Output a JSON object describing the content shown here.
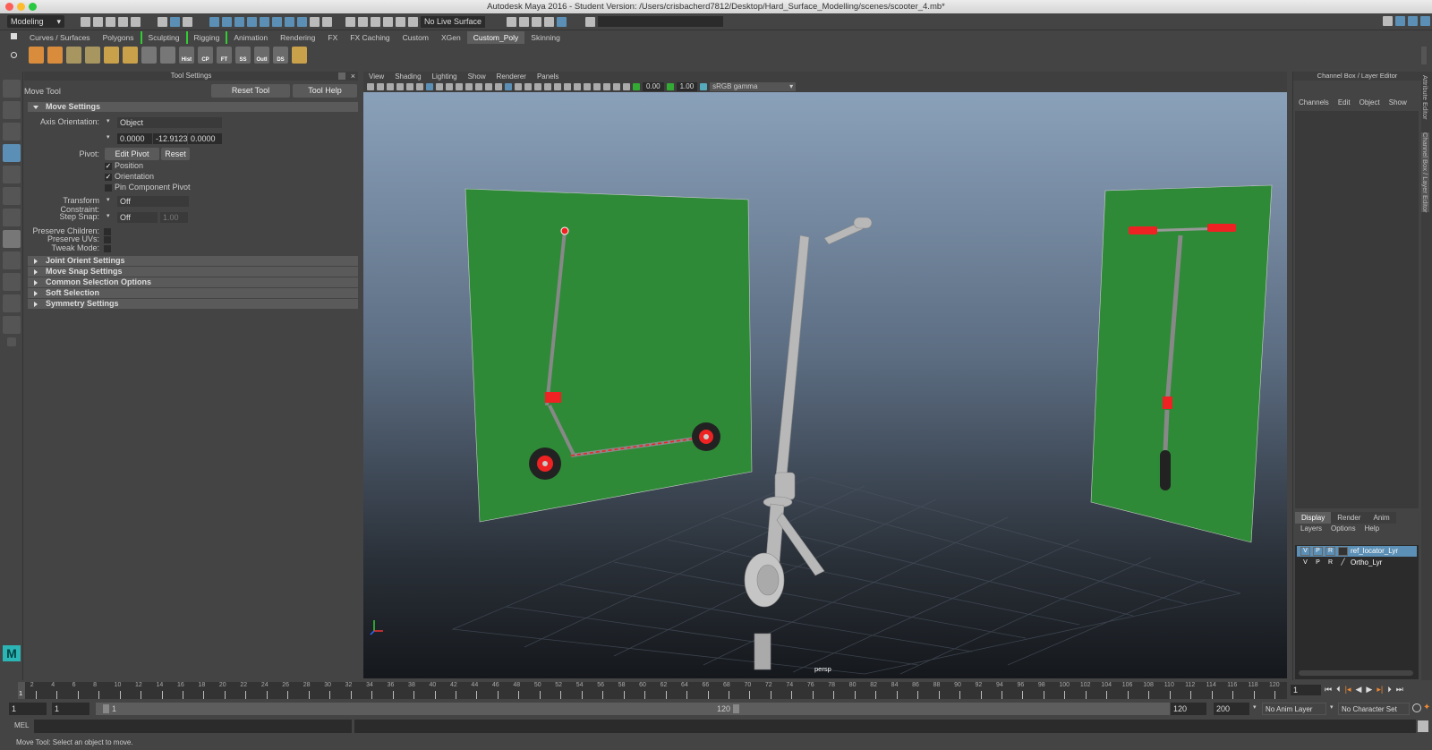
{
  "window": {
    "title": "Autodesk Maya 2016 - Student Version: /Users/crisbacherd7812/Desktop/Hard_Surface_Modelling/scenes/scooter_4.mb*"
  },
  "statusline": {
    "menuset": "Modeling",
    "live_surface": "No Live Surface"
  },
  "shelf": {
    "tabs": [
      "Curves / Surfaces",
      "Polygons",
      "Sculpting",
      "Rigging",
      "Animation",
      "Rendering",
      "FX",
      "FX Caching",
      "Custom",
      "XGen",
      "Custom_Poly",
      "Skinning"
    ],
    "active_tab": "Custom_Poly",
    "buttons": [
      "",
      "",
      "",
      "",
      "",
      "",
      "",
      "Hist",
      "CP",
      "FT",
      "SS",
      "Outl",
      "DS",
      ""
    ]
  },
  "tool_settings": {
    "header": "Tool Settings",
    "tool_name": "Move Tool",
    "reset_tool": "Reset Tool",
    "tool_help": "Tool Help",
    "move_settings": "Move Settings",
    "axis_orientation_label": "Axis Orientation:",
    "axis_orientation": "Object",
    "axis_values": [
      "0.0000",
      "-12.9123",
      "0.0000"
    ],
    "pivot_label": "Pivot:",
    "edit_pivot": "Edit Pivot",
    "reset": "Reset",
    "position": "Position",
    "position_checked": true,
    "orientation": "Orientation",
    "orientation_checked": true,
    "pin_component_pivot": "Pin Component Pivot",
    "pin_checked": false,
    "transform_constraint_label": "Transform Constraint:",
    "transform_constraint": "Off",
    "step_snap_label": "Step Snap:",
    "step_snap": "Off",
    "step_snap_value": "1.00",
    "preserve_children": "Preserve Children:",
    "preserve_uvs": "Preserve UVs:",
    "tweak_mode": "Tweak Mode:",
    "sections": [
      "Joint Orient Settings",
      "Move Snap Settings",
      "Common Selection Options",
      "Soft Selection",
      "Symmetry Settings"
    ]
  },
  "viewport": {
    "menus": [
      "View",
      "Shading",
      "Lighting",
      "Show",
      "Renderer",
      "Panels"
    ],
    "exposure": "0.00",
    "gamma": "1.00",
    "color_space": "sRGB gamma",
    "camera": "persp"
  },
  "channel_box": {
    "header": "Channel Box / Layer Editor",
    "menus": [
      "Channels",
      "Edit",
      "Object",
      "Show"
    ]
  },
  "layer_editor": {
    "tabs": [
      "Display",
      "Render",
      "Anim"
    ],
    "active_tab": "Display",
    "menus": [
      "Layers",
      "Options",
      "Help"
    ],
    "layers": [
      {
        "v": "V",
        "p": "P",
        "r": "R",
        "name": "ref_locator_Lyr",
        "selected": true
      },
      {
        "v": "V",
        "p": "P",
        "r": "R",
        "name": "Ortho_Lyr",
        "selected": false
      }
    ]
  },
  "side_tabs": [
    "Attribute Editor",
    "Channel Box / Layer Editor"
  ],
  "timeline": {
    "ticks": [
      2,
      4,
      6,
      8,
      10,
      12,
      14,
      16,
      18,
      20,
      22,
      24,
      26,
      28,
      30,
      32,
      34,
      36,
      38,
      40,
      42,
      44,
      46,
      48,
      50,
      52,
      54,
      56,
      58,
      60,
      62,
      64,
      66,
      68,
      70,
      72,
      74,
      76,
      78,
      80,
      82,
      84,
      86,
      88,
      90,
      92,
      94,
      96,
      98,
      100,
      102,
      104,
      106,
      108,
      110,
      112,
      114,
      116,
      118,
      120
    ],
    "current_marker": "1",
    "current_frame": "1",
    "min": 1,
    "max": 120
  },
  "range": {
    "start": "1",
    "playback_start": "1",
    "slider_start": "1",
    "slider_end": "120",
    "playback_end": "120",
    "end": "200",
    "anim_layer": "No Anim Layer",
    "character_set": "No Character Set"
  },
  "command_line": {
    "label": "MEL"
  },
  "help_line": "Move Tool: Select an object to move."
}
